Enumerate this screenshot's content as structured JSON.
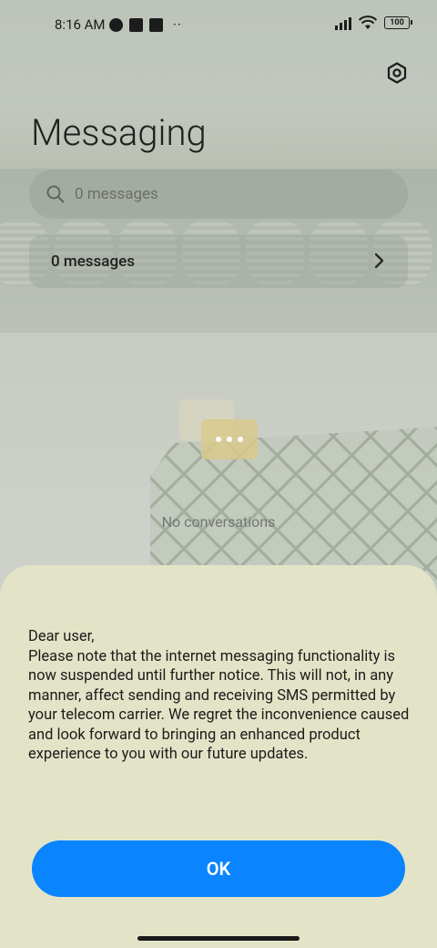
{
  "status_bar": {
    "time": "8:16 AM",
    "battery": "100"
  },
  "app": {
    "title": "Messaging",
    "search_placeholder": "0 messages",
    "messages_card_label": "0 messages",
    "empty_text": "No conversations"
  },
  "dialog": {
    "greeting": "Dear user,",
    "body": "Please note that the internet messaging functionality is now suspended until further notice. This will not, in any manner, affect sending and receiving SMS permitted by your telecom carrier. We regret the inconvenience caused and look forward to bringing an enhanced product experience to you with our future updates.",
    "ok_label": "OK"
  },
  "colors": {
    "accent": "#0a84ff",
    "sheet": "#e3e4c7"
  }
}
